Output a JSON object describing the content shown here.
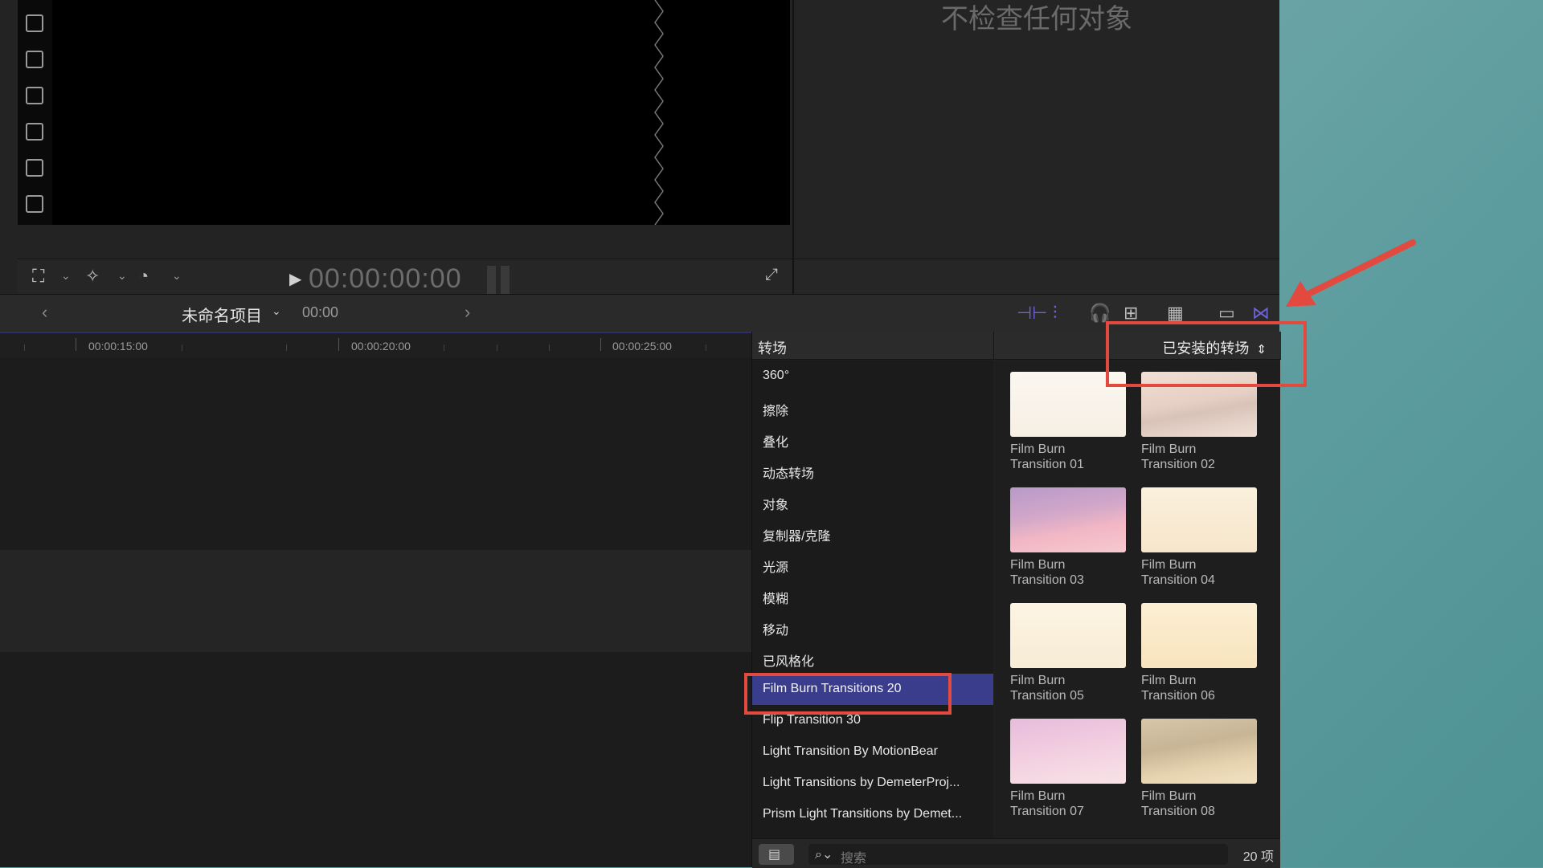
{
  "viewer": {
    "timecode": "00:00:00:00",
    "inspector_title": "不检查任何对象"
  },
  "timeline_toolbar": {
    "project_name": "未命名项目",
    "project_time": "00:00"
  },
  "ruler": {
    "labels": [
      "00:00:15:00",
      "00:00:20:00",
      "00:00:25:00"
    ]
  },
  "browser": {
    "category_title": "转场",
    "installed_selector": "已安装的转场",
    "categories": [
      "360°",
      "擦除",
      "叠化",
      "动态转场",
      "对象",
      "复制器/克隆",
      "光源",
      "模糊",
      "移动",
      "已风格化",
      "Film Burn Transitions 20",
      "Flip Transition 30",
      "Light Transition By MotionBear",
      "Light Transitions by DemeterProj...",
      "Prism Light Transitions by Demet..."
    ],
    "selected_category": "Film Burn Transitions 20",
    "thumbnails": [
      {
        "line1": "Film Burn",
        "line2": "Transition 01"
      },
      {
        "line1": "Film Burn",
        "line2": "Transition 02"
      },
      {
        "line1": "Film Burn",
        "line2": "Transition 03"
      },
      {
        "line1": "Film Burn",
        "line2": "Transition 04"
      },
      {
        "line1": "Film Burn",
        "line2": "Transition 05"
      },
      {
        "line1": "Film Burn",
        "line2": "Transition 06"
      },
      {
        "line1": "Film Burn",
        "line2": "Transition 07"
      },
      {
        "line1": "Film Burn",
        "line2": "Transition 08"
      }
    ],
    "search_placeholder": "搜索",
    "item_count": "20 项"
  },
  "annotation_color": "#e24a40",
  "selection_color": "#3a3d8c",
  "icons": [
    "transform-icon",
    "magic-wand-icon",
    "speed-icon",
    "play-icon",
    "fullscreen-icon",
    "back-icon",
    "forward-icon",
    "headphones-icon",
    "browser-icon",
    "search-icon",
    "transitions-icon"
  ]
}
